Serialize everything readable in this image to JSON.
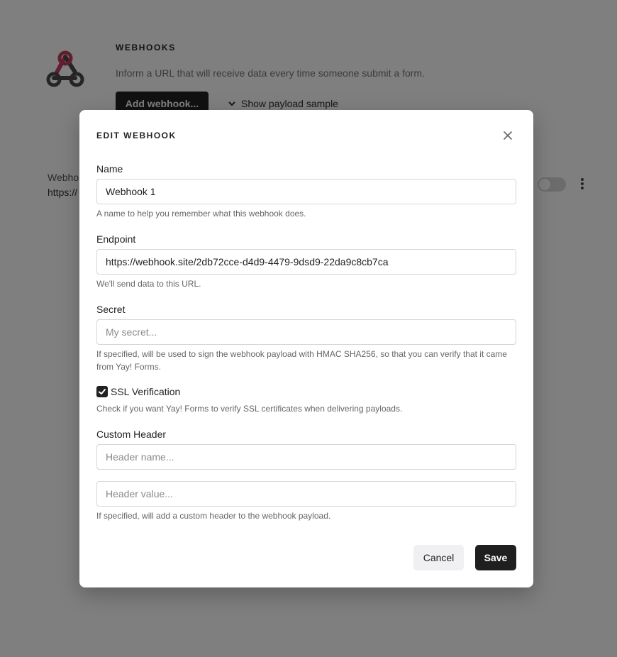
{
  "background": {
    "section_title": "WEBHOOKS",
    "description": "Inform a URL that will receive data every time someone submit a form.",
    "add_button": "Add webhook...",
    "payload_toggle": "Show payload sample",
    "row_name": "Webho",
    "row_url": "https://"
  },
  "modal": {
    "title": "EDIT WEBHOOK",
    "name": {
      "label": "Name",
      "value": "Webhook 1",
      "hint": "A name to help you remember what this webhook does."
    },
    "endpoint": {
      "label": "Endpoint",
      "value": "https://webhook.site/2db72cce-d4d9-4479-9dsd9-22da9c8cb7ca",
      "hint": "We'll send data to this URL."
    },
    "secret": {
      "label": "Secret",
      "placeholder": "My secret...",
      "hint": "If specified, will be used to sign the webhook payload with HMAC SHA256, so that you can verify that it came from Yay! Forms."
    },
    "ssl": {
      "label": "SSL Verification",
      "checked": true,
      "hint": "Check if you want Yay! Forms to verify SSL certificates when delivering payloads."
    },
    "custom_header": {
      "label": "Custom Header",
      "name_placeholder": "Header name...",
      "value_placeholder": "Header value...",
      "hint": "If specified, will add a custom header to the webhook payload."
    },
    "cancel_label": "Cancel",
    "save_label": "Save"
  },
  "colors": {
    "logo_pink": "#c73a63",
    "logo_dark": "#4a4a4a",
    "primary": "#1f1f1f"
  }
}
